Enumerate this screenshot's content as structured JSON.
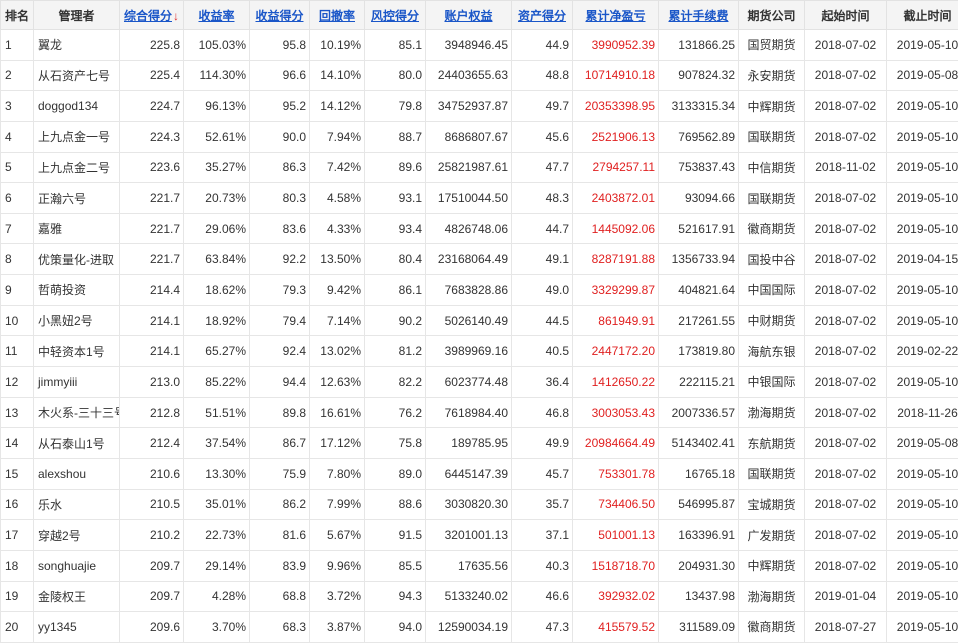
{
  "table": {
    "headers": {
      "rank": "排名",
      "manager": "管理者",
      "composite_score": "综合得分",
      "yield": "收益率",
      "yield_score": "收益得分",
      "drawdown": "回撤率",
      "risk_score": "风控得分",
      "equity": "账户权益",
      "asset_score": "资产得分",
      "net_profit": "累计净盈亏",
      "fees": "累计手续费",
      "futures_company": "期货公司",
      "start_date": "起始时间",
      "end_date": "截止时间"
    },
    "sort_arrow": "↓",
    "colors": {
      "link": "#1a56c8",
      "net_profit": "#e02020",
      "sort_arrow": "#e03030",
      "header_bg": "#f4f4f4"
    },
    "rows": [
      {
        "rank": "1",
        "manager": "翼龙",
        "composite_score": "225.8",
        "yield": "105.03%",
        "yield_score": "95.8",
        "drawdown": "10.19%",
        "risk_score": "85.1",
        "equity": "3948946.45",
        "asset_score": "44.9",
        "net_profit": "3990952.39",
        "fees": "131866.25",
        "futures_company": "国贸期货",
        "start_date": "2018-07-02",
        "end_date": "2019-05-10"
      },
      {
        "rank": "2",
        "manager": "从石资产七号",
        "composite_score": "225.4",
        "yield": "114.30%",
        "yield_score": "96.6",
        "drawdown": "14.10%",
        "risk_score": "80.0",
        "equity": "24403655.63",
        "asset_score": "48.8",
        "net_profit": "10714910.18",
        "fees": "907824.32",
        "futures_company": "永安期货",
        "start_date": "2018-07-02",
        "end_date": "2019-05-08"
      },
      {
        "rank": "3",
        "manager": "doggod134",
        "composite_score": "224.7",
        "yield": "96.13%",
        "yield_score": "95.2",
        "drawdown": "14.12%",
        "risk_score": "79.8",
        "equity": "34752937.87",
        "asset_score": "49.7",
        "net_profit": "20353398.95",
        "fees": "3133315.34",
        "futures_company": "中辉期货",
        "start_date": "2018-07-02",
        "end_date": "2019-05-10"
      },
      {
        "rank": "4",
        "manager": "上九点金一号",
        "composite_score": "224.3",
        "yield": "52.61%",
        "yield_score": "90.0",
        "drawdown": "7.94%",
        "risk_score": "88.7",
        "equity": "8686807.67",
        "asset_score": "45.6",
        "net_profit": "2521906.13",
        "fees": "769562.89",
        "futures_company": "国联期货",
        "start_date": "2018-07-02",
        "end_date": "2019-05-10"
      },
      {
        "rank": "5",
        "manager": "上九点金二号",
        "composite_score": "223.6",
        "yield": "35.27%",
        "yield_score": "86.3",
        "drawdown": "7.42%",
        "risk_score": "89.6",
        "equity": "25821987.61",
        "asset_score": "47.7",
        "net_profit": "2794257.11",
        "fees": "753837.43",
        "futures_company": "中信期货",
        "start_date": "2018-11-02",
        "end_date": "2019-05-10"
      },
      {
        "rank": "6",
        "manager": "正瀚六号",
        "composite_score": "221.7",
        "yield": "20.73%",
        "yield_score": "80.3",
        "drawdown": "4.58%",
        "risk_score": "93.1",
        "equity": "17510044.50",
        "asset_score": "48.3",
        "net_profit": "2403872.01",
        "fees": "93094.66",
        "futures_company": "国联期货",
        "start_date": "2018-07-02",
        "end_date": "2019-05-10"
      },
      {
        "rank": "7",
        "manager": "嘉雅",
        "composite_score": "221.7",
        "yield": "29.06%",
        "yield_score": "83.6",
        "drawdown": "4.33%",
        "risk_score": "93.4",
        "equity": "4826748.06",
        "asset_score": "44.7",
        "net_profit": "1445092.06",
        "fees": "521617.91",
        "futures_company": "徽商期货",
        "start_date": "2018-07-02",
        "end_date": "2019-05-10"
      },
      {
        "rank": "8",
        "manager": "优策量化-进取",
        "composite_score": "221.7",
        "yield": "63.84%",
        "yield_score": "92.2",
        "drawdown": "13.50%",
        "risk_score": "80.4",
        "equity": "23168064.49",
        "asset_score": "49.1",
        "net_profit": "8287191.88",
        "fees": "1356733.94",
        "futures_company": "国投中谷",
        "start_date": "2018-07-02",
        "end_date": "2019-04-15"
      },
      {
        "rank": "9",
        "manager": "哲萌投资",
        "composite_score": "214.4",
        "yield": "18.62%",
        "yield_score": "79.3",
        "drawdown": "9.42%",
        "risk_score": "86.1",
        "equity": "7683828.86",
        "asset_score": "49.0",
        "net_profit": "3329299.87",
        "fees": "404821.64",
        "futures_company": "中国国际",
        "start_date": "2018-07-02",
        "end_date": "2019-05-10"
      },
      {
        "rank": "10",
        "manager": "小黑妞2号",
        "composite_score": "214.1",
        "yield": "18.92%",
        "yield_score": "79.4",
        "drawdown": "7.14%",
        "risk_score": "90.2",
        "equity": "5026140.49",
        "asset_score": "44.5",
        "net_profit": "861949.91",
        "fees": "217261.55",
        "futures_company": "中财期货",
        "start_date": "2018-07-02",
        "end_date": "2019-05-10"
      },
      {
        "rank": "11",
        "manager": "中轻资本1号",
        "composite_score": "214.1",
        "yield": "65.27%",
        "yield_score": "92.4",
        "drawdown": "13.02%",
        "risk_score": "81.2",
        "equity": "3989969.16",
        "asset_score": "40.5",
        "net_profit": "2447172.20",
        "fees": "173819.80",
        "futures_company": "海航东银",
        "start_date": "2018-07-02",
        "end_date": "2019-02-22"
      },
      {
        "rank": "12",
        "manager": "jimmyiii",
        "composite_score": "213.0",
        "yield": "85.22%",
        "yield_score": "94.4",
        "drawdown": "12.63%",
        "risk_score": "82.2",
        "equity": "6023774.48",
        "asset_score": "36.4",
        "net_profit": "1412650.22",
        "fees": "222115.21",
        "futures_company": "中银国际",
        "start_date": "2018-07-02",
        "end_date": "2019-05-10"
      },
      {
        "rank": "13",
        "manager": "木火系-三十三号",
        "composite_score": "212.8",
        "yield": "51.51%",
        "yield_score": "89.8",
        "drawdown": "16.61%",
        "risk_score": "76.2",
        "equity": "7618984.40",
        "asset_score": "46.8",
        "net_profit": "3003053.43",
        "fees": "2007336.57",
        "futures_company": "渤海期货",
        "start_date": "2018-07-02",
        "end_date": "2018-11-26"
      },
      {
        "rank": "14",
        "manager": "从石泰山1号",
        "composite_score": "212.4",
        "yield": "37.54%",
        "yield_score": "86.7",
        "drawdown": "17.12%",
        "risk_score": "75.8",
        "equity": "189785.95",
        "asset_score": "49.9",
        "net_profit": "20984664.49",
        "fees": "5143402.41",
        "futures_company": "东航期货",
        "start_date": "2018-07-02",
        "end_date": "2019-05-08"
      },
      {
        "rank": "15",
        "manager": "alexshou",
        "composite_score": "210.6",
        "yield": "13.30%",
        "yield_score": "75.9",
        "drawdown": "7.80%",
        "risk_score": "89.0",
        "equity": "6445147.39",
        "asset_score": "45.7",
        "net_profit": "753301.78",
        "fees": "16765.18",
        "futures_company": "国联期货",
        "start_date": "2018-07-02",
        "end_date": "2019-05-10"
      },
      {
        "rank": "16",
        "manager": "乐水",
        "composite_score": "210.5",
        "yield": "35.01%",
        "yield_score": "86.2",
        "drawdown": "7.99%",
        "risk_score": "88.6",
        "equity": "3030820.30",
        "asset_score": "35.7",
        "net_profit": "734406.50",
        "fees": "546995.87",
        "futures_company": "宝城期货",
        "start_date": "2018-07-02",
        "end_date": "2019-05-10"
      },
      {
        "rank": "17",
        "manager": "穿越2号",
        "composite_score": "210.2",
        "yield": "22.73%",
        "yield_score": "81.6",
        "drawdown": "5.67%",
        "risk_score": "91.5",
        "equity": "3201001.13",
        "asset_score": "37.1",
        "net_profit": "501001.13",
        "fees": "163396.91",
        "futures_company": "广发期货",
        "start_date": "2018-07-02",
        "end_date": "2019-05-10"
      },
      {
        "rank": "18",
        "manager": "songhuajie",
        "composite_score": "209.7",
        "yield": "29.14%",
        "yield_score": "83.9",
        "drawdown": "9.96%",
        "risk_score": "85.5",
        "equity": "17635.56",
        "asset_score": "40.3",
        "net_profit": "1518718.70",
        "fees": "204931.30",
        "futures_company": "中辉期货",
        "start_date": "2018-07-02",
        "end_date": "2019-05-10"
      },
      {
        "rank": "19",
        "manager": "金陵权王",
        "composite_score": "209.7",
        "yield": "4.28%",
        "yield_score": "68.8",
        "drawdown": "3.72%",
        "risk_score": "94.3",
        "equity": "5133240.02",
        "asset_score": "46.6",
        "net_profit": "392932.02",
        "fees": "13437.98",
        "futures_company": "渤海期货",
        "start_date": "2019-01-04",
        "end_date": "2019-05-10"
      },
      {
        "rank": "20",
        "manager": "yy1345",
        "composite_score": "209.6",
        "yield": "3.70%",
        "yield_score": "68.3",
        "drawdown": "3.87%",
        "risk_score": "94.0",
        "equity": "12590034.19",
        "asset_score": "47.3",
        "net_profit": "415579.52",
        "fees": "311589.09",
        "futures_company": "徽商期货",
        "start_date": "2018-07-27",
        "end_date": "2019-05-10"
      }
    ]
  }
}
